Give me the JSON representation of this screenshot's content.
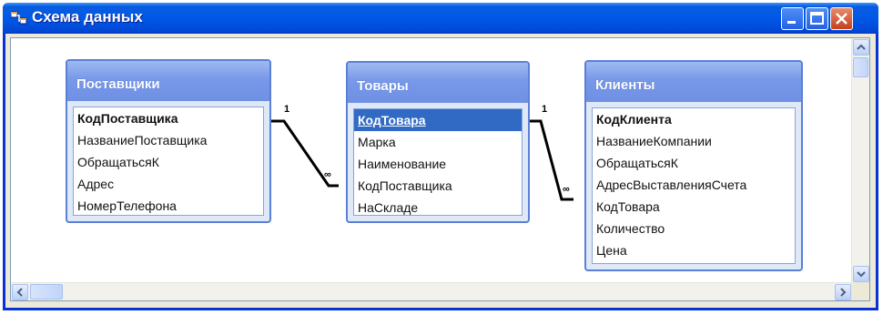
{
  "window": {
    "title": "Схема данных",
    "icon": "relationships-icon"
  },
  "tables": [
    {
      "name": "Поставщики",
      "fields": [
        {
          "label": "КодПоставщика",
          "primary_key": true,
          "selected": false
        },
        {
          "label": "НазваниеПоставщика",
          "primary_key": false,
          "selected": false
        },
        {
          "label": "ОбращатьсяК",
          "primary_key": false,
          "selected": false
        },
        {
          "label": "Адрес",
          "primary_key": false,
          "selected": false
        },
        {
          "label": "НомерТелефона",
          "primary_key": false,
          "selected": false
        }
      ]
    },
    {
      "name": "Товары",
      "fields": [
        {
          "label": "КодТовара",
          "primary_key": true,
          "selected": true
        },
        {
          "label": "Марка",
          "primary_key": false,
          "selected": false
        },
        {
          "label": "Наименование",
          "primary_key": false,
          "selected": false
        },
        {
          "label": "КодПоставщика",
          "primary_key": false,
          "selected": false
        },
        {
          "label": "НаСкладе",
          "primary_key": false,
          "selected": false
        }
      ]
    },
    {
      "name": "Клиенты",
      "fields": [
        {
          "label": "КодКлиента",
          "primary_key": true,
          "selected": false
        },
        {
          "label": "НазваниеКомпании",
          "primary_key": false,
          "selected": false
        },
        {
          "label": "ОбращатьсяК",
          "primary_key": false,
          "selected": false
        },
        {
          "label": "АдресВыставленияСчета",
          "primary_key": false,
          "selected": false
        },
        {
          "label": "КодТовара",
          "primary_key": false,
          "selected": false
        },
        {
          "label": "Количество",
          "primary_key": false,
          "selected": false
        },
        {
          "label": "Цена",
          "primary_key": false,
          "selected": false
        }
      ]
    }
  ],
  "relationships": [
    {
      "one_label": "1",
      "many_label": "∞"
    },
    {
      "one_label": "1",
      "many_label": "∞"
    }
  ],
  "colors": {
    "titlebar": "#0058e6",
    "table_header": "#7898e8",
    "selection": "#316ac5",
    "relationship_line": "#000000"
  }
}
